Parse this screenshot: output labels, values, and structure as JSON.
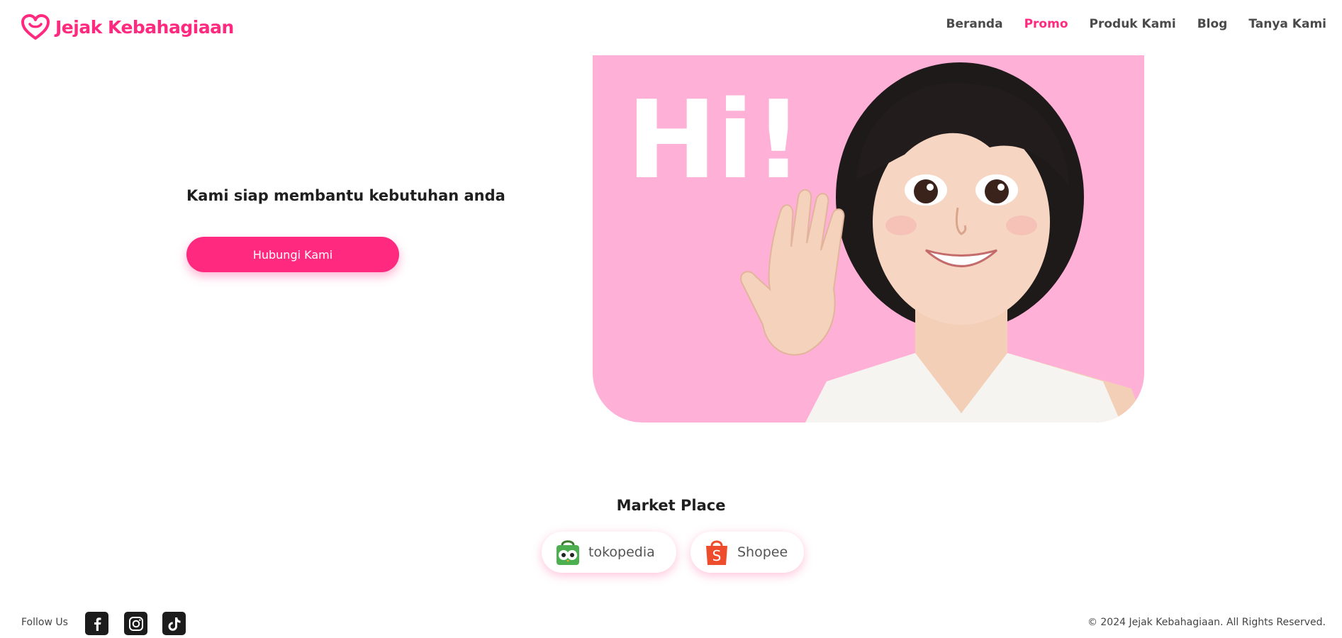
{
  "header": {
    "brand_name": "Jejak Kebahagiaan",
    "brand_icon": "heart-logo-icon",
    "nav": [
      {
        "label": "Beranda",
        "active": false
      },
      {
        "label": "Promo",
        "active": true
      },
      {
        "label": "Produk Kami",
        "active": false
      },
      {
        "label": "Blog",
        "active": false
      },
      {
        "label": "Tanya Kami",
        "active": false
      }
    ]
  },
  "hero": {
    "headline": "Kami siap membantu kebutuhan anda",
    "cta_label": "Hubungi Kami",
    "image_text": "Hi!",
    "image_icon": "waving-girl-illustration"
  },
  "marketplace": {
    "title": "Market Place",
    "items": [
      {
        "label": "tokopedia",
        "icon": "tokopedia-bag-icon"
      },
      {
        "label": "Shopee",
        "icon": "shopee-bag-icon"
      }
    ]
  },
  "footer": {
    "follow_label": "Follow Us",
    "social": [
      "facebook-icon",
      "instagram-icon",
      "tiktok-icon"
    ],
    "copyright": "© 2024 Jejak Kebahagiaan. All Rights Reserved."
  },
  "colors": {
    "accent": "#ff2a7f",
    "hero_bg": "#ffb0d7",
    "text": "#1f1f1f"
  }
}
